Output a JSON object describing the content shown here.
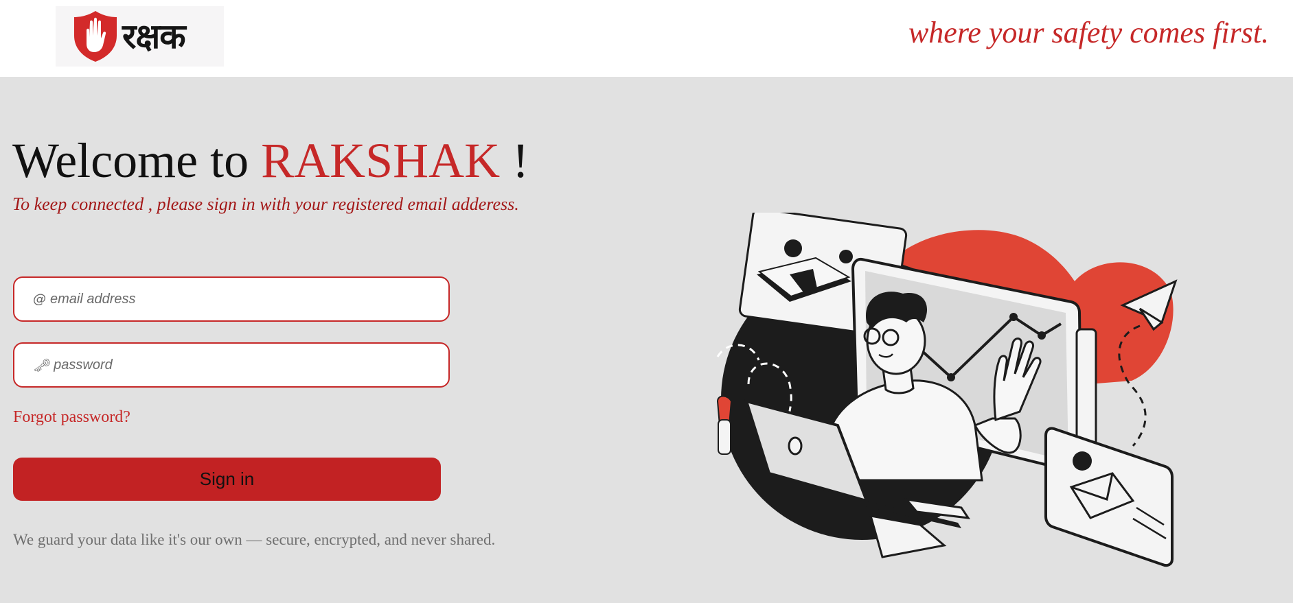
{
  "header": {
    "logo_text": "रक्षक",
    "tagline": "where your safety comes first."
  },
  "main": {
    "welcome_prefix": "Welcome to ",
    "brand_name": "RAKSHAK",
    "welcome_suffix": " !",
    "subtitle": "To keep connected , please sign in with your registered email adderess.",
    "email": {
      "icon": "@",
      "placeholder": "email address",
      "value": ""
    },
    "password": {
      "icon": "🗝",
      "placeholder": "password",
      "value": ""
    },
    "forgot_label": "Forgot password?",
    "signin_label": "Sign in",
    "privacy_note": "We guard your data like it's our own — secure, encrypted, and never shared."
  },
  "icons": {
    "logo": "shield-hand-icon",
    "email": "at-icon",
    "password": "key-icon"
  },
  "colors": {
    "accent": "#c62828",
    "button": "#c22223",
    "background": "#e1e1e1",
    "illustration_red": "#e04535"
  }
}
